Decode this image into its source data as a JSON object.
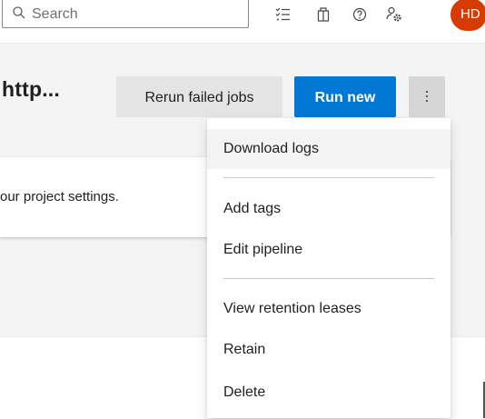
{
  "header": {
    "search_placeholder": "Search",
    "icons": [
      "search-icon",
      "task-list-icon",
      "marketplace-bag-icon",
      "help-icon",
      "user-settings-icon"
    ],
    "avatar_initials": "HD",
    "avatar_color": "#d83b01"
  },
  "page": {
    "title_fragment": "http...",
    "rerun_label": "Rerun failed jobs",
    "run_new_label": "Run new",
    "more_actions_icon": "more-vertical-icon",
    "notice_text_fragment": "our project settings."
  },
  "menu": {
    "items": [
      {
        "label": "Download logs"
      },
      {
        "label": "Add tags"
      },
      {
        "label": "Edit pipeline"
      },
      {
        "label": "View retention leases"
      },
      {
        "label": "Retain"
      },
      {
        "label": "Delete"
      }
    ]
  },
  "colors": {
    "primary": "#0078d4",
    "secondary_button": "#e4e4e4",
    "background": "#f4f4f4"
  }
}
